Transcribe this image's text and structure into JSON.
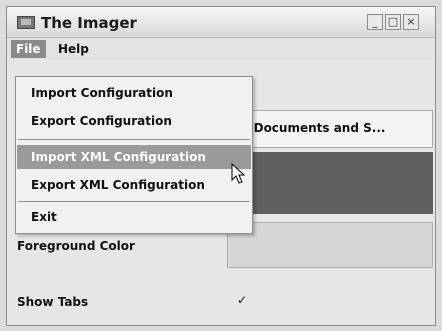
{
  "window": {
    "title": "The Imager"
  },
  "title_buttons": {
    "minimize": "_",
    "maximize": "□",
    "close": "×"
  },
  "menubar": {
    "file": "File",
    "help": "Help"
  },
  "file_menu": {
    "items": [
      "Import Configuration",
      "Export Configuration",
      "Import XML Configuration",
      "Export XML Configuration",
      "Exit"
    ],
    "hovered": "Import XML Configuration"
  },
  "form": {
    "path_value": "C:Documents and S...",
    "foreground_label": "Foreground Color",
    "show_tabs_label": "Show Tabs",
    "show_tabs_checked": true,
    "check_mark": "✓"
  },
  "colors": {
    "dark_band": "#5f5f5f",
    "menu_highlight": "#9a9a9a"
  }
}
